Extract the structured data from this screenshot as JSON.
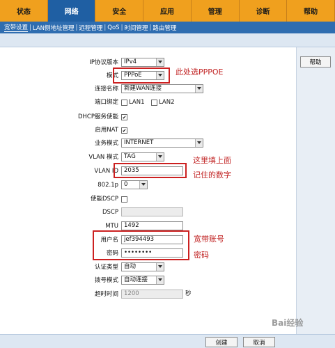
{
  "nav": {
    "tabs": [
      {
        "label": "状态"
      },
      {
        "label": "网络"
      },
      {
        "label": "安全"
      },
      {
        "label": "应用"
      },
      {
        "label": "管理"
      },
      {
        "label": "诊断"
      },
      {
        "label": "帮助"
      }
    ],
    "subtabs": [
      {
        "label": "宽带设置"
      },
      {
        "label": "LAN侧地址管理"
      },
      {
        "label": "远程管理"
      },
      {
        "label": "QoS"
      },
      {
        "label": "时间管理"
      },
      {
        "label": "路由管理"
      }
    ]
  },
  "help_button": "帮助",
  "form": {
    "ip_version": {
      "label": "IP协议版本",
      "value": "IPv4"
    },
    "mode": {
      "label": "模式",
      "value": "PPPoE"
    },
    "connection_name": {
      "label": "连接名称",
      "value": "新建WAN连接"
    },
    "port_binding": {
      "label": "端口绑定",
      "options": [
        "LAN1",
        "LAN2"
      ]
    },
    "dhcp_service": {
      "label": "DHCP服务使能"
    },
    "enable_nat": {
      "label": "启用NAT"
    },
    "service_mode": {
      "label": "业务模式",
      "value": "INTERNET"
    },
    "vlan_mode": {
      "label": "VLAN 模式",
      "value": "TAG"
    },
    "vlan_id": {
      "label": "VLAN ID",
      "value": "2035"
    },
    "dot1p": {
      "label": "802.1p",
      "value": "0"
    },
    "enable_dscp": {
      "label": "使能DSCP"
    },
    "dscp": {
      "label": "DSCP",
      "value": ""
    },
    "mtu": {
      "label": "MTU",
      "value": "1492"
    },
    "username": {
      "label": "用户名",
      "value": "jef394493"
    },
    "password": {
      "label": "密码",
      "value": "••••••••"
    },
    "auth_type": {
      "label": "认证类型",
      "value": "自动"
    },
    "dial_mode": {
      "label": "拨号模式",
      "value": "自动连接"
    },
    "timeout": {
      "label": "超时时间",
      "value": "1200",
      "unit": "秒"
    }
  },
  "annotations": {
    "mode_note": "此处选PPPOE",
    "vlan_note_line1": "这里填上面",
    "vlan_note_line2": "记住的数字",
    "account_note_line1": "宽带账号",
    "account_note_line2": "密码"
  },
  "buttons": {
    "create": "创建",
    "cancel": "取消"
  },
  "watermark": "Bai经验",
  "colors": {
    "nav_orange": "#f0a01e",
    "nav_active_blue": "#1f5fa3",
    "annotation_red": "#cc2020"
  }
}
